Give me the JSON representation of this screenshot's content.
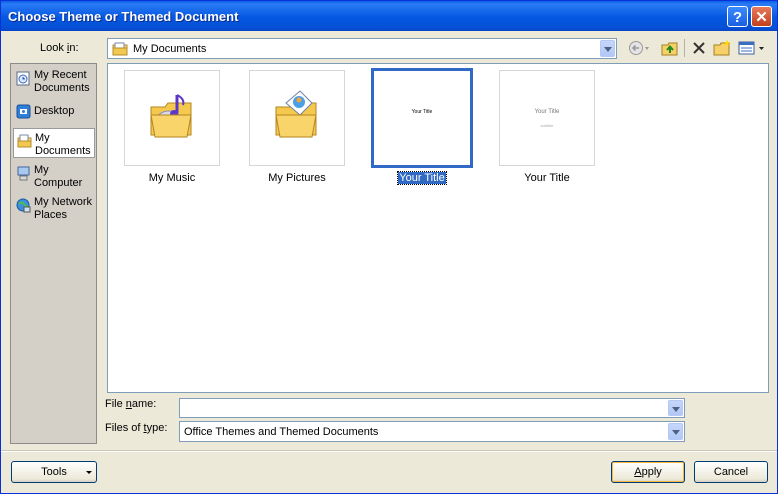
{
  "window": {
    "title": "Choose Theme or Themed Document",
    "help_glyph": "?",
    "close_glyph": "✕"
  },
  "lookin": {
    "label_pre": "Look ",
    "label_u": "i",
    "label_post": "n:",
    "value": "My Documents"
  },
  "toolbar_icons": [
    "back-icon",
    "up-folder-icon",
    "delete-icon",
    "new-folder-icon",
    "views-icon"
  ],
  "places": [
    {
      "name": "recent",
      "label_1": "My Recent",
      "label_2": "Documents",
      "icon": "recent-documents-icon"
    },
    {
      "name": "desktop",
      "label_1": "Desktop",
      "label_2": "",
      "icon": "desktop-icon"
    },
    {
      "name": "mydocs",
      "label_1": "My",
      "label_2": "Documents",
      "icon": "my-documents-icon",
      "selected": true
    },
    {
      "name": "computer",
      "label_1": "My",
      "label_2": "Computer",
      "icon": "my-computer-icon"
    },
    {
      "name": "network",
      "label_1": "My Network",
      "label_2": "Places",
      "icon": "network-places-icon"
    }
  ],
  "items": [
    {
      "label": "My Music",
      "icon": "music-folder-icon"
    },
    {
      "label": "My Pictures",
      "icon": "pictures-folder-icon"
    },
    {
      "label": "Your Title",
      "thumb_title": "Your Title",
      "selected": true
    },
    {
      "label": "Your Title",
      "thumb_title": "Your Title",
      "thumb_subtitle": "subtitle"
    }
  ],
  "filename": {
    "label_pre": "File ",
    "label_u": "n",
    "label_post": "ame:",
    "value": ""
  },
  "filetype": {
    "label_pre": "Files of ",
    "label_u": "t",
    "label_post": "ype:",
    "value": "Office Themes and Themed Documents"
  },
  "buttons": {
    "tools": "Tools",
    "apply_u": "A",
    "apply_rest": "pply",
    "cancel": "Cancel"
  },
  "colors": {
    "title_bar": "#0557e2",
    "selection": "#316ac5",
    "dialog_bg": "#ece9d8"
  }
}
